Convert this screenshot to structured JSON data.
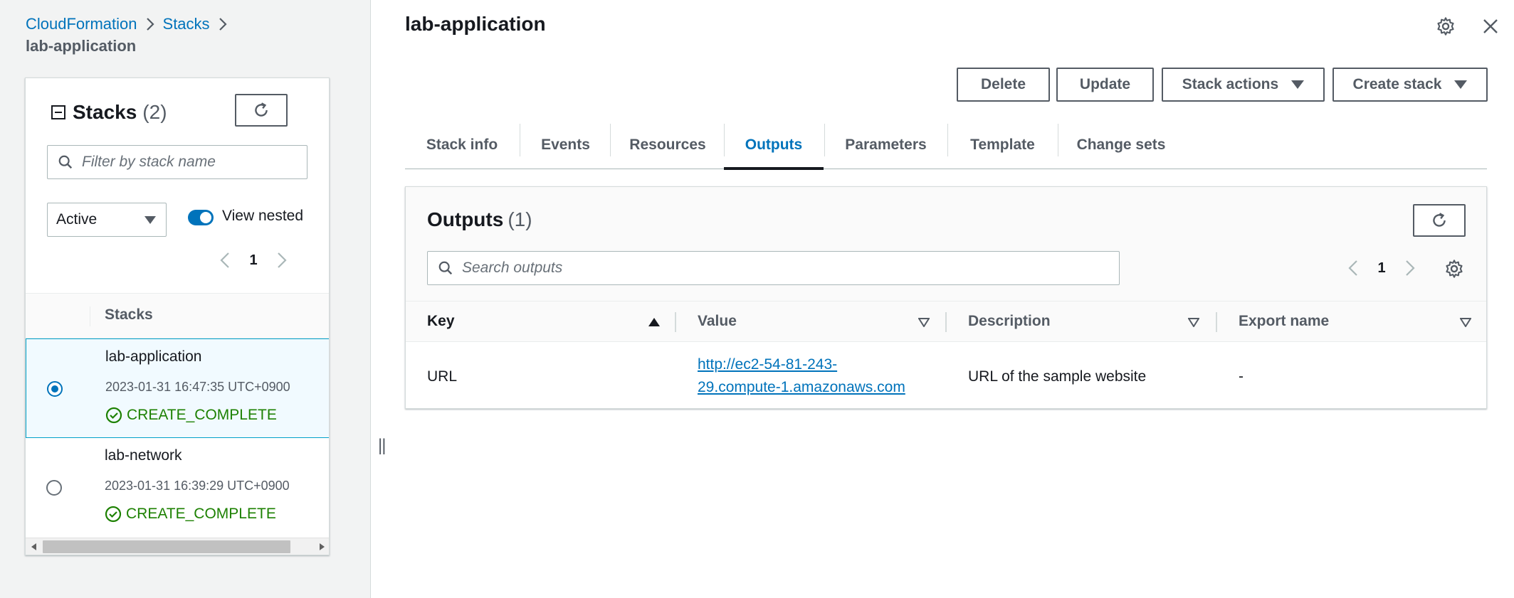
{
  "breadcrumb": {
    "items": [
      "CloudFormation",
      "Stacks"
    ],
    "current": "lab-application"
  },
  "stacks_panel": {
    "title": "Stacks",
    "count": "(2)",
    "filter_placeholder": "Filter by stack name",
    "status_filter": "Active",
    "view_nested_label": "View nested",
    "view_nested_enabled": true,
    "page": "1",
    "column_header": "Stacks",
    "rows": [
      {
        "name": "lab-application",
        "created": "2023-01-31 16:47:35 UTC+0900",
        "status": "CREATE_COMPLETE",
        "selected": true
      },
      {
        "name": "lab-network",
        "created": "2023-01-31 16:39:29 UTC+0900",
        "status": "CREATE_COMPLETE",
        "selected": false
      }
    ]
  },
  "detail": {
    "title": "lab-application",
    "actions": {
      "delete": "Delete",
      "update": "Update",
      "stack_actions": "Stack actions",
      "create_stack": "Create stack"
    },
    "tabs": [
      "Stack info",
      "Events",
      "Resources",
      "Outputs",
      "Parameters",
      "Template",
      "Change sets"
    ],
    "active_tab": "Outputs",
    "outputs": {
      "title": "Outputs",
      "count": "(1)",
      "search_placeholder": "Search outputs",
      "page": "1",
      "columns": [
        "Key",
        "Value",
        "Description",
        "Export name"
      ],
      "rows": [
        {
          "key": "URL",
          "value_line1": "http://ec2-54-81-243-",
          "value_line2": "29.compute-1.amazonaws.com",
          "description": "URL of the sample website",
          "export_name": "-"
        }
      ]
    }
  },
  "colors": {
    "link": "#0073bb",
    "success": "#1d8102",
    "text": "#16191f",
    "muted": "#545b64",
    "panel_bg": "#f2f3f3"
  }
}
